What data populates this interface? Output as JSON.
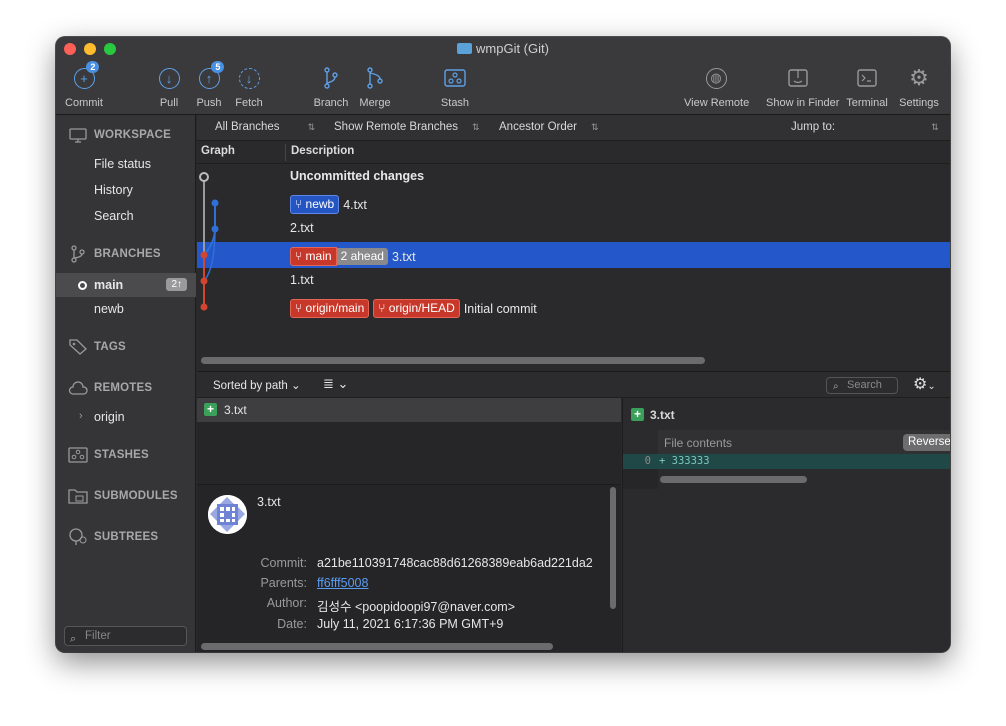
{
  "window": {
    "title": "wmpGit (Git)"
  },
  "toolbar": {
    "commit": {
      "label": "Commit",
      "badge": "2"
    },
    "pull": {
      "label": "Pull"
    },
    "push": {
      "label": "Push",
      "badge": "5"
    },
    "fetch": {
      "label": "Fetch"
    },
    "branch": {
      "label": "Branch"
    },
    "merge": {
      "label": "Merge"
    },
    "stash": {
      "label": "Stash"
    },
    "view_remote": {
      "label": "View Remote"
    },
    "show_in_finder": {
      "label": "Show in Finder"
    },
    "terminal": {
      "label": "Terminal"
    },
    "settings": {
      "label": "Settings"
    }
  },
  "sidebar": {
    "workspace": {
      "title": "WORKSPACE",
      "items": [
        "File status",
        "History",
        "Search"
      ]
    },
    "branches": {
      "title": "BRANCHES",
      "items": [
        {
          "name": "main",
          "ahead": "2↑",
          "current": true
        },
        {
          "name": "newb"
        }
      ]
    },
    "tags": {
      "title": "TAGS"
    },
    "remotes": {
      "title": "REMOTES",
      "items": [
        "origin"
      ]
    },
    "stashes": {
      "title": "STASHES"
    },
    "submodules": {
      "title": "SUBMODULES"
    },
    "subtrees": {
      "title": "SUBTREES"
    },
    "filter_placeholder": "Filter"
  },
  "filterbar": {
    "branches": "All Branches",
    "remote": "Show Remote Branches",
    "order": "Ancestor Order",
    "jump": "Jump to:"
  },
  "columns": {
    "graph": "Graph",
    "description": "Description"
  },
  "commits": [
    {
      "text": "Uncommitted changes",
      "refs": []
    },
    {
      "text": "4.txt",
      "refs": [
        {
          "label": "newb",
          "color": "blue"
        }
      ]
    },
    {
      "text": "2.txt",
      "refs": []
    },
    {
      "text": "3.txt",
      "refs": [
        {
          "label": "main",
          "color": "red"
        },
        {
          "label": "2 ahead",
          "color": "gray"
        }
      ],
      "selected": true
    },
    {
      "text": "1.txt",
      "refs": []
    },
    {
      "text": "Initial commit",
      "refs": [
        {
          "label": "origin/main",
          "color": "red"
        },
        {
          "label": "origin/HEAD",
          "color": "red"
        }
      ]
    }
  ],
  "lower": {
    "sort": "Sorted by path",
    "search_placeholder": "Search",
    "files": [
      {
        "name": "3.txt",
        "status": "added"
      }
    ],
    "diff": {
      "file": "3.txt",
      "hunk_title": "File contents",
      "reverse_button": "Reverse hun",
      "lines": [
        {
          "num": "0",
          "text": "+ 333333"
        }
      ]
    },
    "details": {
      "subject": "3.txt",
      "labels": {
        "commit": "Commit:",
        "parents": "Parents:",
        "author": "Author:",
        "date": "Date:"
      },
      "commit": "a21be110391748cac88d61268389eab6ad221da2",
      "parents": "ff6fff5008",
      "author": "김성수 <poopidoopi97@naver.com>",
      "date": "July 11, 2021 6:17:36 PM GMT+9"
    }
  },
  "colors": {
    "selection": "#2457c9",
    "branch_blue": "#2455c2",
    "branch_red": "#c8382a",
    "graph_gray": "#9a9a9a"
  }
}
